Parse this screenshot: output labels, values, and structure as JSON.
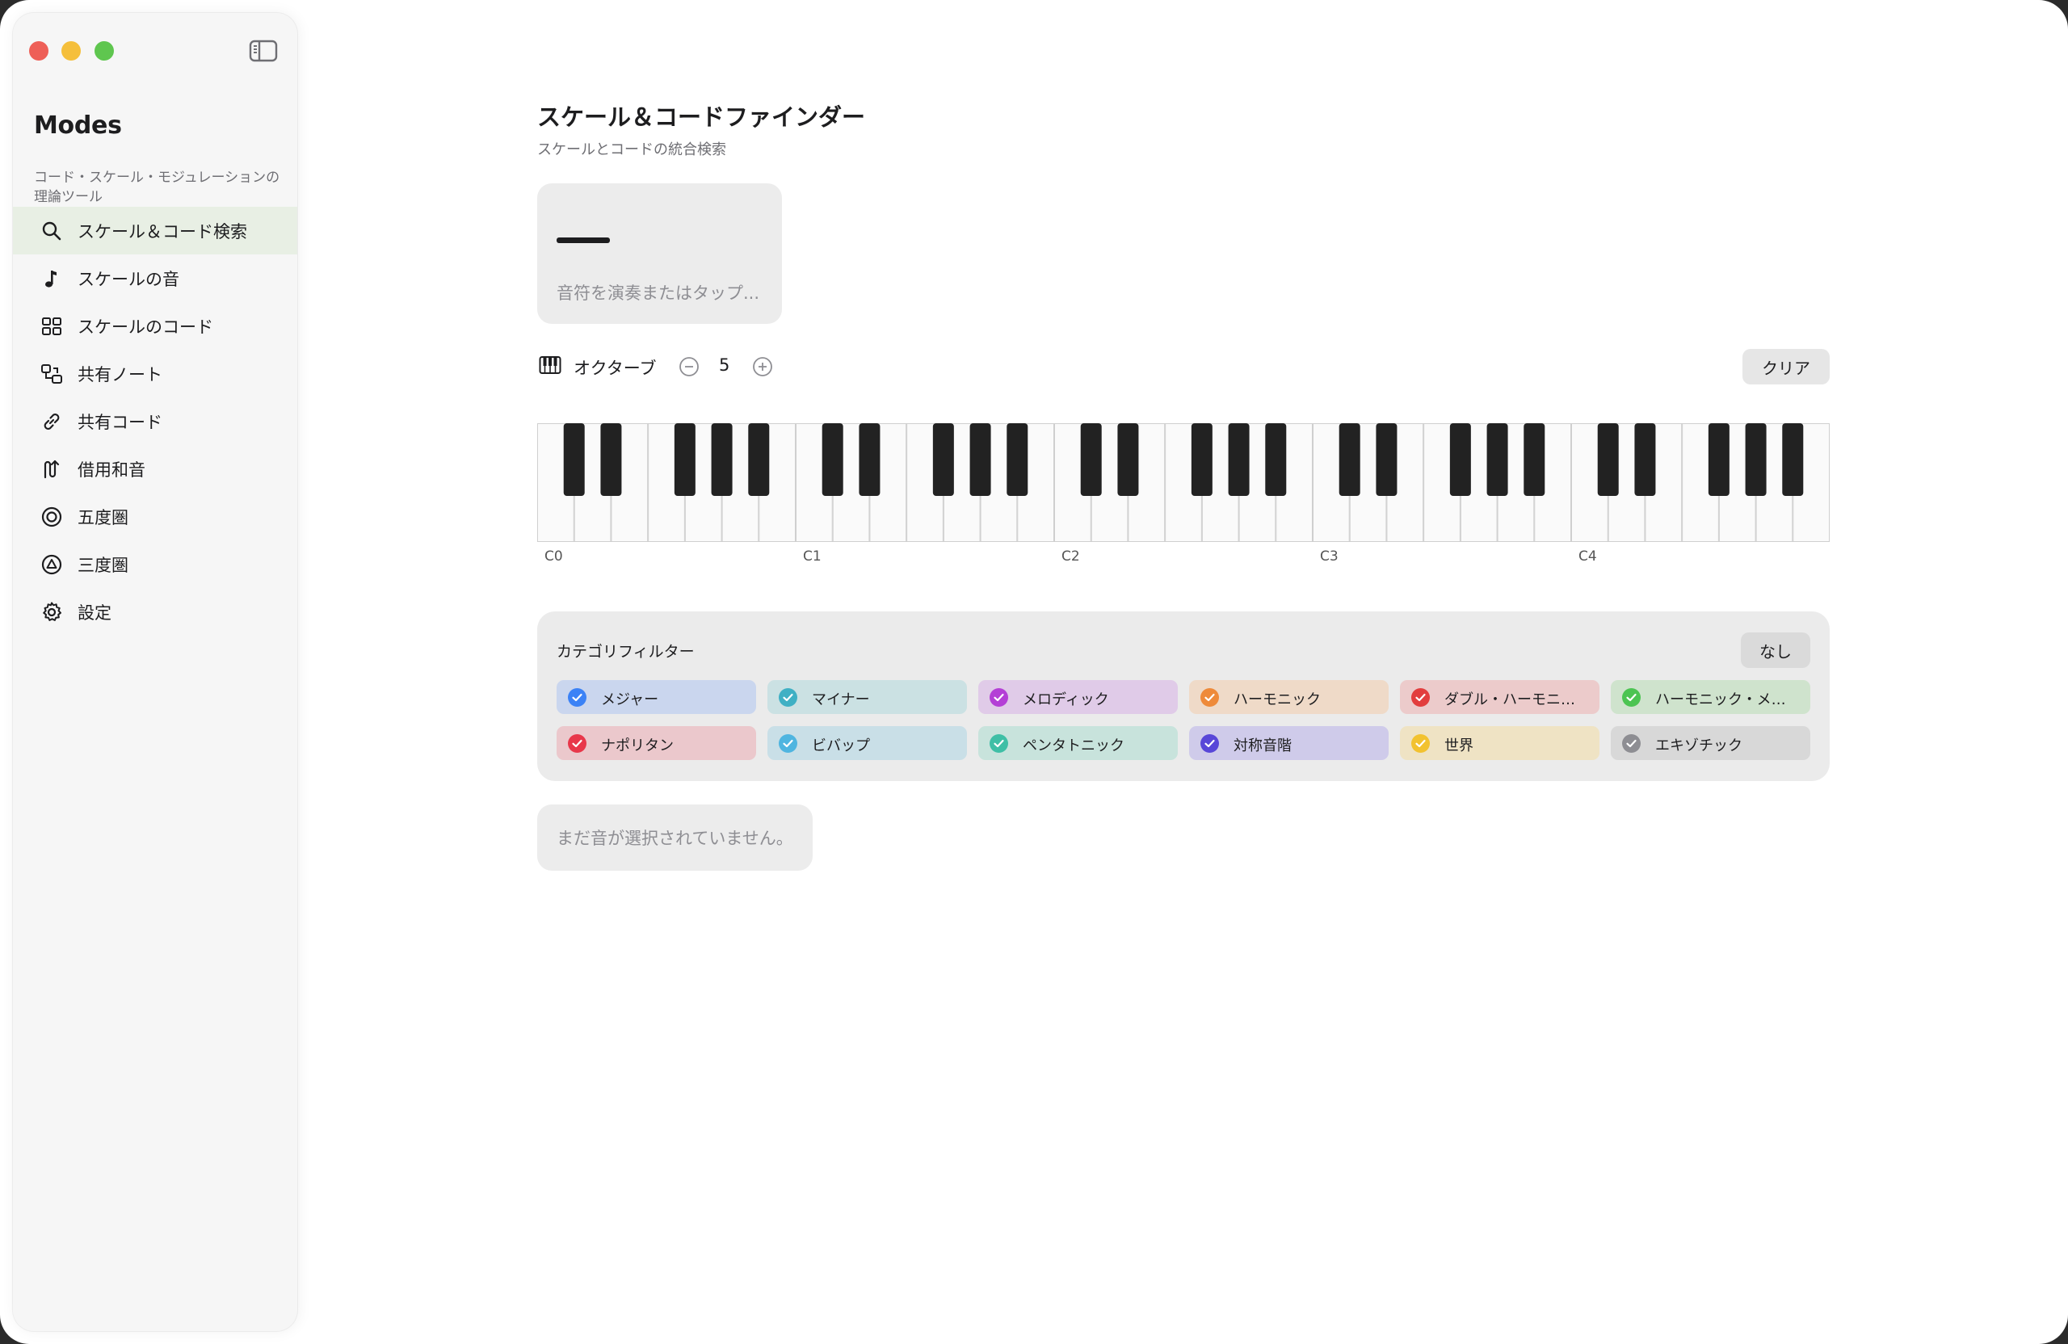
{
  "sidebar": {
    "app_name": "Modes",
    "app_subtitle": "コード・スケール・モジュレーションの理論ツール",
    "items": [
      {
        "label": "スケール＆コード検索",
        "icon": "search-icon",
        "active": true
      },
      {
        "label": "スケールの音",
        "icon": "music-note-icon"
      },
      {
        "label": "スケールのコード",
        "icon": "grid-icon"
      },
      {
        "label": "共有ノート",
        "icon": "shared-notes-icon"
      },
      {
        "label": "共有コード",
        "icon": "link-icon"
      },
      {
        "label": "借用和音",
        "icon": "borrowed-chord-icon"
      },
      {
        "label": "五度圏",
        "icon": "circle-of-fifths-icon"
      },
      {
        "label": "三度圏",
        "icon": "circle-of-thirds-icon"
      },
      {
        "label": "設定",
        "icon": "gear-icon"
      }
    ]
  },
  "main": {
    "title": "スケール＆コードファインダー",
    "subtitle": "スケールとコードの統合検索",
    "note_display": {
      "placeholder": "音符を演奏またはタップ..."
    },
    "octave": {
      "label": "オクターブ",
      "value": "5",
      "clear_label": "クリア"
    },
    "piano": {
      "octave_labels": [
        "C0",
        "C1",
        "C2",
        "C3",
        "C4"
      ],
      "white_keys": 35
    },
    "filter": {
      "title": "カテゴリフィルター",
      "none_label": "なし",
      "categories": [
        {
          "label": "メジャー",
          "color": "#3b82f6",
          "bg": "#cad6ee"
        },
        {
          "label": "マイナー",
          "color": "#3fb0c4",
          "bg": "#cbe1e3"
        },
        {
          "label": "メロディック",
          "color": "#b43fd6",
          "bg": "#e0cbe8"
        },
        {
          "label": "ハーモニック",
          "color": "#ee8a3a",
          "bg": "#efdac8"
        },
        {
          "label": "ダブル・ハーモニ…",
          "color": "#e23e3e",
          "bg": "#eccbcb"
        },
        {
          "label": "ハーモニック・メ…",
          "color": "#4cc452",
          "bg": "#cfe3cd"
        },
        {
          "label": "ナポリタン",
          "color": "#e8374a",
          "bg": "#ebc8cc"
        },
        {
          "label": "ビバップ",
          "color": "#4fb5e0",
          "bg": "#c9dfe7"
        },
        {
          "label": "ペンタトニック",
          "color": "#3fbfa6",
          "bg": "#c8e3dc"
        },
        {
          "label": "対称音階",
          "color": "#5847d8",
          "bg": "#cfcbea"
        },
        {
          "label": "世界",
          "color": "#f2c230",
          "bg": "#efe3c4"
        },
        {
          "label": "エキゾチック",
          "color": "#8e8e93",
          "bg": "#d8d8d8"
        }
      ]
    },
    "empty_message": "まだ音が選択されていません。"
  }
}
